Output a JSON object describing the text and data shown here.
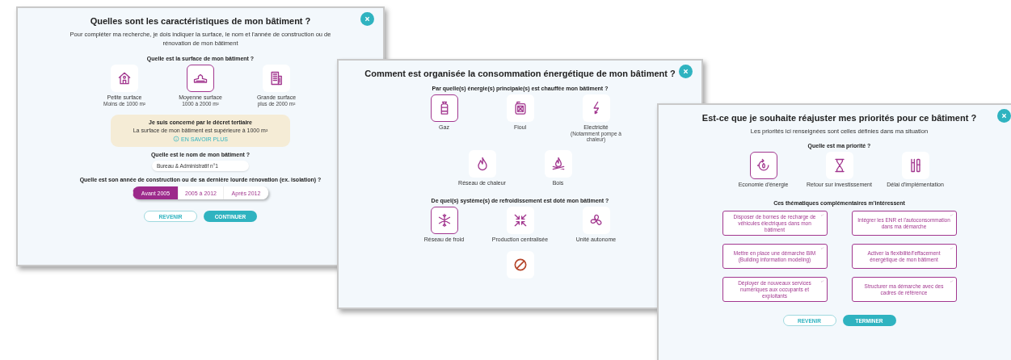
{
  "dialogs": [
    {
      "title": "Quelles sont les caractéristiques de mon bâtiment ?",
      "blocks": [
        {
          "kind": "intro",
          "text": "Pour compléter ma recherche, je dois indiquer la surface, le nom et l'année de construction ou de rénovation de mon bâtiment"
        },
        {
          "kind": "question",
          "text": "Quelle est la surface de mon bâtiment ?"
        },
        {
          "kind": "tiles",
          "options": [
            {
              "label": "Petite surface",
              "sublabel": "Moins de 1000 m²",
              "selected": false
            },
            {
              "label": "Moyenne surface",
              "sublabel": "1000 à 2000 m²",
              "selected": true
            },
            {
              "label": "Grande surface",
              "sublabel": "plus de 2000 m²",
              "selected": false
            }
          ]
        },
        {
          "kind": "notice",
          "title": "Je suis concerné par le décret tertiaire",
          "text": "La surface de mon bâtiment est supérieure à 1000 m²",
          "link": "EN SAVOIR PLUS"
        },
        {
          "kind": "question",
          "text": "Quelle est le nom de mon bâtiment ?"
        },
        {
          "kind": "field",
          "value": "Bureau & Administratif n°1"
        },
        {
          "kind": "question",
          "text": "Quelle est son année de construction ou de sa dernière lourde rénovation (ex. isolation) ?"
        },
        {
          "kind": "segmented",
          "options": [
            {
              "label": "Avant 2005",
              "selected": true
            },
            {
              "label": "2005 à 2012",
              "selected": false
            },
            {
              "label": "Après 2012",
              "selected": false
            }
          ]
        },
        {
          "kind": "buttons",
          "buttons": [
            {
              "label": "REVENIR",
              "kind": "secondary"
            },
            {
              "label": "CONTINUER",
              "kind": "primary"
            }
          ]
        }
      ]
    },
    {
      "title": "Comment est organisée la consommation énergétique de mon bâtiment ?",
      "blocks": [
        {
          "kind": "question",
          "text": "Par quelle(s) énergie(s) principale(s) est chauffée mon bâtiment ?"
        },
        {
          "kind": "tiles",
          "options": [
            {
              "label": "Gaz",
              "selected": true
            },
            {
              "label": "Fioul",
              "selected": false
            },
            {
              "label": "Electricité",
              "sublabel": "(Notamment pompe à chaleur)",
              "selected": false
            }
          ]
        },
        {
          "kind": "tiles",
          "options": [
            {
              "label": "Réseau de chaleur",
              "selected": false
            },
            {
              "label": "Bois",
              "selected": false
            }
          ]
        },
        {
          "kind": "question",
          "text": "De quel(s) système(s) de refroidissement est doté mon bâtiment ?"
        },
        {
          "kind": "tiles",
          "options": [
            {
              "label": "Réseau de froid",
              "selected": true
            },
            {
              "label": "Production centralisée",
              "selected": false
            },
            {
              "label": "Unité autonome",
              "selected": false
            }
          ]
        },
        {
          "kind": "tiles",
          "options": [
            {
              "selected": false
            }
          ]
        }
      ]
    },
    {
      "title": "Est-ce que je souhaite réajuster mes priorités pour ce bâtiment ?",
      "blocks": [
        {
          "kind": "intro",
          "text": "Les priorités ici renseignées sont celles définies dans ma situation"
        },
        {
          "kind": "question",
          "text": "Quelle est ma priorité ?"
        },
        {
          "kind": "tiles",
          "options": [
            {
              "label": "Economie d'énergie",
              "selected": true
            },
            {
              "label": "Retour sur investissement",
              "selected": false
            },
            {
              "label": "Délai d'implémentation",
              "selected": false
            }
          ]
        },
        {
          "kind": "question",
          "text": "Ces thématiques complémentaires m'intéressent"
        },
        {
          "kind": "cards",
          "cards": [
            "Disposer de bornes de recharge de véhicules électriques dans mon bâtiment",
            "Intégrer les ENR et l'autoconsommation dans ma démarche",
            "Mettre en place une démarche BIM (Building information modeling)",
            "Activer la flexibilité/l'effacement énergétique de mon bâtiment",
            "Déployer de nouveaux services numériques aux occupants et exploitants",
            "Structurer ma démarche avec des cadres de référence"
          ]
        },
        {
          "kind": "buttons",
          "buttons": [
            {
              "label": "REVENIR",
              "kind": "secondary"
            },
            {
              "label": "TERMINER",
              "kind": "primary"
            }
          ]
        }
      ]
    }
  ]
}
